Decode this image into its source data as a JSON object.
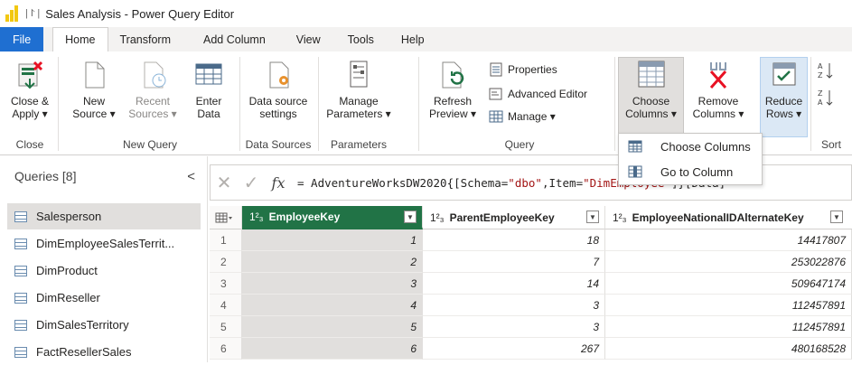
{
  "window": {
    "quick_access": "| ⨡ |",
    "title": "Sales Analysis - Power Query Editor"
  },
  "tabs": [
    {
      "label": "File"
    },
    {
      "label": "Home"
    },
    {
      "label": "Transform"
    },
    {
      "label": "Add Column"
    },
    {
      "label": "View"
    },
    {
      "label": "Tools"
    },
    {
      "label": "Help"
    }
  ],
  "ribbon": {
    "close_apply": {
      "line1": "Close &",
      "line2": "Apply ▾"
    },
    "new_source": {
      "line1": "New",
      "line2": "Source ▾"
    },
    "recent_sources": {
      "line1": "Recent",
      "line2": "Sources ▾"
    },
    "enter_data": {
      "line1": "Enter",
      "line2": "Data"
    },
    "data_source_settings": {
      "line1": "Data source",
      "line2": "settings"
    },
    "manage_parameters": {
      "line1": "Manage",
      "line2": "Parameters ▾"
    },
    "refresh_preview": {
      "line1": "Refresh",
      "line2": "Preview ▾"
    },
    "properties": "Properties",
    "advanced_editor": "Advanced Editor",
    "manage": "Manage ▾",
    "choose_columns": {
      "line1": "Choose",
      "line2": "Columns ▾"
    },
    "remove_columns": {
      "line1": "Remove",
      "line2": "Columns ▾"
    },
    "reduce_rows": {
      "line1": "Reduce",
      "line2": "Rows ▾"
    },
    "groups": {
      "close": "Close",
      "new_query": "New Query",
      "data_sources": "Data Sources",
      "parameters": "Parameters",
      "query": "Query",
      "sort": "Sort"
    }
  },
  "dropdown_menu": {
    "items": [
      {
        "label": "Choose Columns",
        "icon": "choose-columns-icon"
      },
      {
        "label": "Go to Column",
        "icon": "go-to-column-icon"
      }
    ]
  },
  "queries": {
    "header": "Queries [8]",
    "collapse_glyph": "<",
    "items": [
      {
        "label": "Salesperson"
      },
      {
        "label": "DimEmployeeSalesTerrit..."
      },
      {
        "label": "DimProduct"
      },
      {
        "label": "DimReseller"
      },
      {
        "label": "DimSalesTerritory"
      },
      {
        "label": "FactResellerSales"
      }
    ]
  },
  "formula_bar": {
    "cancel": "✕",
    "confirm": "✓",
    "fx": "fx",
    "pre": "= AdventureWorksDW2020{[Schema=",
    "str1": "\"dbo\"",
    "mid": ",Item=",
    "str2": "\"DimEmployee\"",
    "post": "]}[Data]"
  },
  "grid": {
    "type_glyph": "1²₃",
    "columns": [
      {
        "name": "EmployeeKey"
      },
      {
        "name": "ParentEmployeeKey"
      },
      {
        "name": "EmployeeNationalIDAlternateKey"
      }
    ],
    "rows": [
      {
        "n": "1",
        "c1": "1",
        "c2": "18",
        "c3": "14417807"
      },
      {
        "n": "2",
        "c1": "2",
        "c2": "7",
        "c3": "253022876"
      },
      {
        "n": "3",
        "c1": "3",
        "c2": "14",
        "c3": "509647174"
      },
      {
        "n": "4",
        "c1": "4",
        "c2": "3",
        "c3": "112457891"
      },
      {
        "n": "5",
        "c1": "5",
        "c2": "3",
        "c3": "112457891"
      },
      {
        "n": "6",
        "c1": "6",
        "c2": "267",
        "c3": "480168528"
      }
    ]
  },
  "colors": {
    "accent": "#217346",
    "file_tab": "#1f6fd1",
    "logo": "#f2c811"
  }
}
